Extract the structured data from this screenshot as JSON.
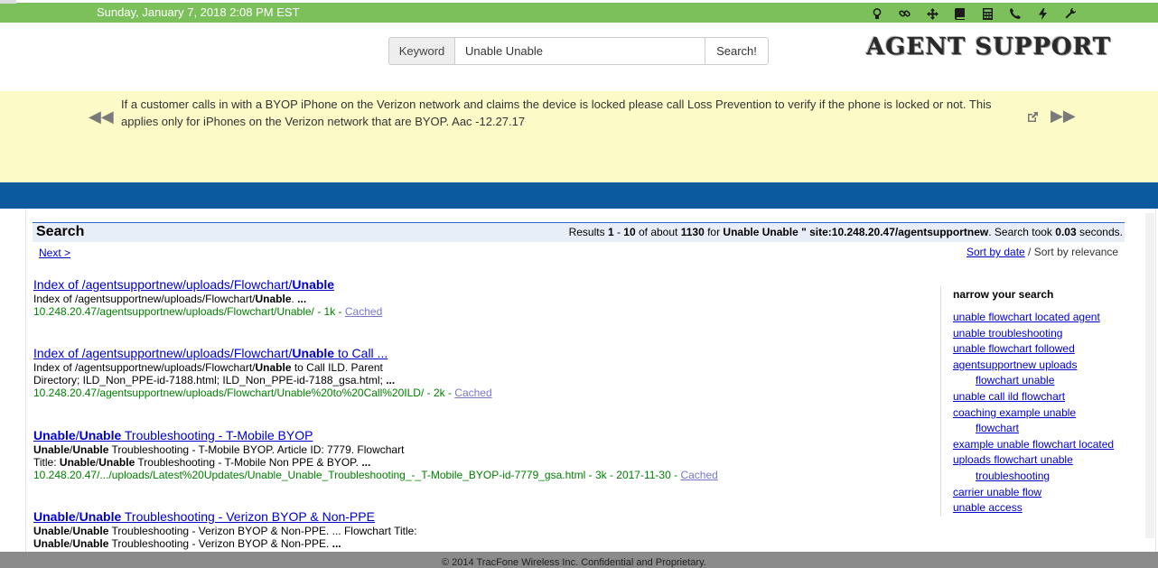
{
  "topbar": {
    "datetime": "Sunday, January 7, 2018 2:08 PM EST",
    "icons": [
      "lightbulb-icon",
      "link-icon",
      "move-icon",
      "book-icon",
      "calculator-icon",
      "phone-icon",
      "bolt-icon",
      "wrench-icon"
    ]
  },
  "search": {
    "addon_label": "Keyword",
    "value": "Unable Unable",
    "button_label": "Search!"
  },
  "logo": "AGENT SUPPORT",
  "announcement": {
    "text": "If a customer calls in with a BYOP iPhone on the Verizon network and claims the device is locked please call Loss Prevention to verify if the phone is locked or not. This applies only for iPhones on the Verizon network that are BYOP. Aac -12.27.17"
  },
  "results_header": {
    "title": "Search",
    "stats_prefix": "Results ",
    "range_start": "1",
    "range_sep": " - ",
    "range_end": "10",
    "of_about": " of about ",
    "total": "1130",
    "for_text": " for ",
    "query": "Unable Unable \" site:10.248.20.47/agentsupportnew",
    "took": ". Search took ",
    "seconds": "0.03",
    "seconds_suffix": " seconds."
  },
  "pager": {
    "next": "Next >"
  },
  "sort": {
    "by_date": "Sort by date",
    "separator": " / Sort by relevance"
  },
  "results": [
    {
      "title_pre": "Index of /agentsupportnew/uploads/Flowchart/",
      "title_bold": "Unable",
      "title_post": "",
      "snippet": [
        [
          "Index of /agentsupportnew/uploads/Flowchart/",
          false
        ],
        [
          "Unable",
          true
        ],
        [
          ". ",
          false
        ],
        [
          "...",
          true
        ]
      ],
      "url": "10.248.20.47/agentsupportnew/uploads/Flowchart/Unable/ - 1k - ",
      "cached": "Cached"
    },
    {
      "title_pre": "Index of /agentsupportnew/uploads/Flowchart/",
      "title_bold": "Unable",
      "title_post": " to Call ...",
      "snippet": [
        [
          "Index of /agentsupportnew/uploads/Flowchart/",
          false
        ],
        [
          "Unable",
          true
        ],
        [
          " to Call ILD. Parent Directory; ILD_Non_PPE-id-7188.html; ILD_Non_PPE-id-7188_gsa.html; ",
          false
        ],
        [
          "...",
          true
        ]
      ],
      "url": "10.248.20.47/agentsupportnew/uploads/Flowchart/Unable%20to%20Call%20ILD/ - 2k - ",
      "cached": "Cached"
    },
    {
      "title_pre": "",
      "title_bold": "Unable",
      "title_mid": "/",
      "title_bold2": "Unable",
      "title_post": " Troubleshooting - T-Mobile BYOP",
      "snippet": [
        [
          "Unable",
          true
        ],
        [
          "/",
          false
        ],
        [
          "Unable",
          true
        ],
        [
          " Troubleshooting - T-Mobile BYOP. Article ID: 7779. Flowchart Title: ",
          false
        ],
        [
          "Unable",
          true
        ],
        [
          "/",
          false
        ],
        [
          "Unable",
          true
        ],
        [
          " Troubleshooting - T-Mobile Non PPE & BYOP. ",
          false
        ],
        [
          "...",
          true
        ]
      ],
      "url": "10.248.20.47/.../uploads/Latest%20Updates/Unable_Unable_Troubleshooting_-_T-Mobile_BYOP-id-7779_gsa.html - 3k - 2017-11-30 - ",
      "cached": "Cached"
    },
    {
      "title_pre": "",
      "title_bold": "Unable",
      "title_mid": "/",
      "title_bold2": "Unable",
      "title_post": " Troubleshooting - Verizon BYOP & Non-PPE",
      "snippet": [
        [
          "Unable",
          true
        ],
        [
          "/",
          false
        ],
        [
          "Unable",
          true
        ],
        [
          " Troubleshooting - Verizon BYOP & Non-PPE. ... Flowchart Title: ",
          false
        ],
        [
          "Unable",
          true
        ],
        [
          "/",
          false
        ],
        [
          "Unable",
          true
        ],
        [
          " Troubleshooting - Verizon BYOP & Non-PPE. ",
          false
        ],
        [
          "...",
          true
        ]
      ],
      "url": "",
      "cached": ""
    }
  ],
  "narrow": {
    "heading": "narrow your search",
    "links": [
      {
        "text": "unable flowchart located agent",
        "indent": false
      },
      {
        "text": "unable troubleshooting",
        "indent": false
      },
      {
        "text": "unable flowchart followed",
        "indent": false
      },
      {
        "text": "agentsupportnew uploads",
        "indent": false
      },
      {
        "text": "flowchart unable",
        "indent": true
      },
      {
        "text": "unable call ild flowchart",
        "indent": false
      },
      {
        "text": "coaching example unable",
        "indent": false
      },
      {
        "text": "flowchart",
        "indent": true
      },
      {
        "text": "example unable flowchart located",
        "indent": false
      },
      {
        "text": "uploads flowchart unable",
        "indent": false
      },
      {
        "text": "troubleshooting",
        "indent": true
      },
      {
        "text": "carrier unable flow",
        "indent": false
      },
      {
        "text": "unable access",
        "indent": false
      }
    ]
  },
  "footer": "© 2014 TracFone Wireless Inc. Confidential and Proprietary."
}
